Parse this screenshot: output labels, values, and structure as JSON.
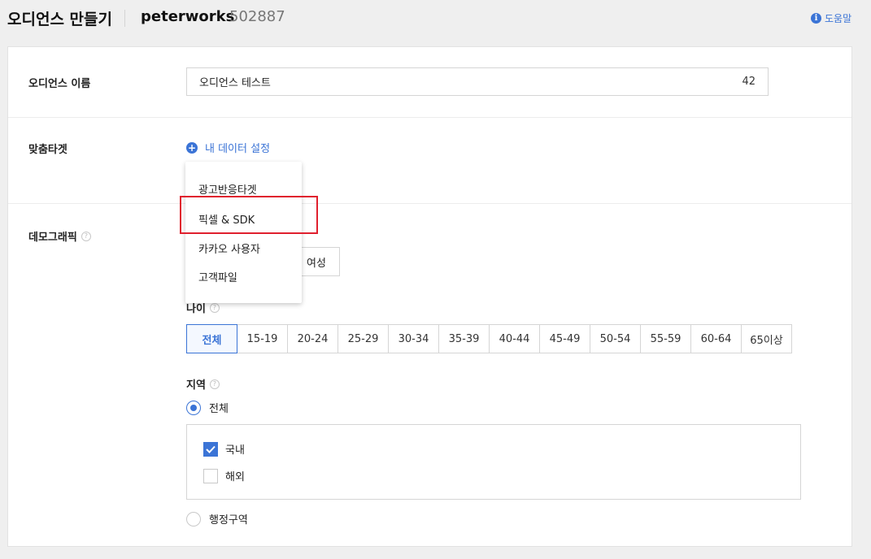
{
  "header": {
    "title": "오디언스 만들기",
    "account_name": "peterworks",
    "account_id": "502887",
    "help_label": "도움말"
  },
  "audience_name": {
    "label": "오디언스 이름",
    "value": "오디언스 테스트",
    "counter": "42"
  },
  "custom_target": {
    "label": "맞춤타겟",
    "add_label": "내 데이터 설정",
    "dropdown_items": [
      "광고반응타겟",
      "픽셀 & SDK",
      "카카오 사용자",
      "고객파일"
    ],
    "highlighted_item": "픽셀 & SDK"
  },
  "demographic": {
    "label": "데모그래픽",
    "gender_visible_option": "여성",
    "age": {
      "label": "나이",
      "options": [
        "전체",
        "15-19",
        "20-24",
        "25-29",
        "30-34",
        "35-39",
        "40-44",
        "45-49",
        "50-54",
        "55-59",
        "60-64",
        "65이상"
      ],
      "selected": "전체"
    },
    "region": {
      "label": "지역",
      "all_label": "전체",
      "all_selected": true,
      "domestic_label": "국내",
      "domestic_checked": true,
      "overseas_label": "해외",
      "overseas_checked": false,
      "admin_label": "행정구역",
      "admin_selected": false
    }
  },
  "colors": {
    "accent": "#3b74d6",
    "highlight_border": "#e0202e"
  }
}
